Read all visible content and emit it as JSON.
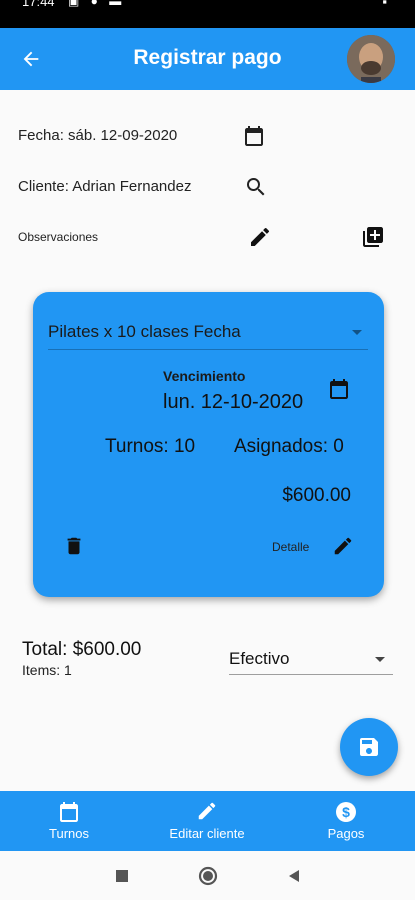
{
  "status_bar": {
    "time": "17:44",
    "battery": "▪"
  },
  "app_bar": {
    "title": "Registrar pago"
  },
  "form": {
    "fecha_label": "Fecha: sáb. 12-09-2020",
    "cliente_label": "Cliente: Adrian Fernandez",
    "observaciones_label": "Observaciones"
  },
  "card": {
    "product": "Pilates x 10 clases Fecha",
    "vencimiento_label": "Vencimiento",
    "vencimiento_date": "lun. 12-10-2020",
    "turnos": "Turnos: 10",
    "asignados": "Asignados: 0",
    "amount": "$600.00",
    "detalle_label": "Detalle"
  },
  "summary": {
    "total": "Total: $600.00",
    "items": "Items: 1",
    "payment_method": "Efectivo"
  },
  "bottom_nav": [
    {
      "label": "Turnos",
      "icon": "calendar-icon"
    },
    {
      "label": "Editar cliente",
      "icon": "pencil-icon"
    },
    {
      "label": "Pagos",
      "icon": "dollar-icon"
    }
  ],
  "colors": {
    "primary": "#2196f3",
    "background": "#fafafa"
  }
}
